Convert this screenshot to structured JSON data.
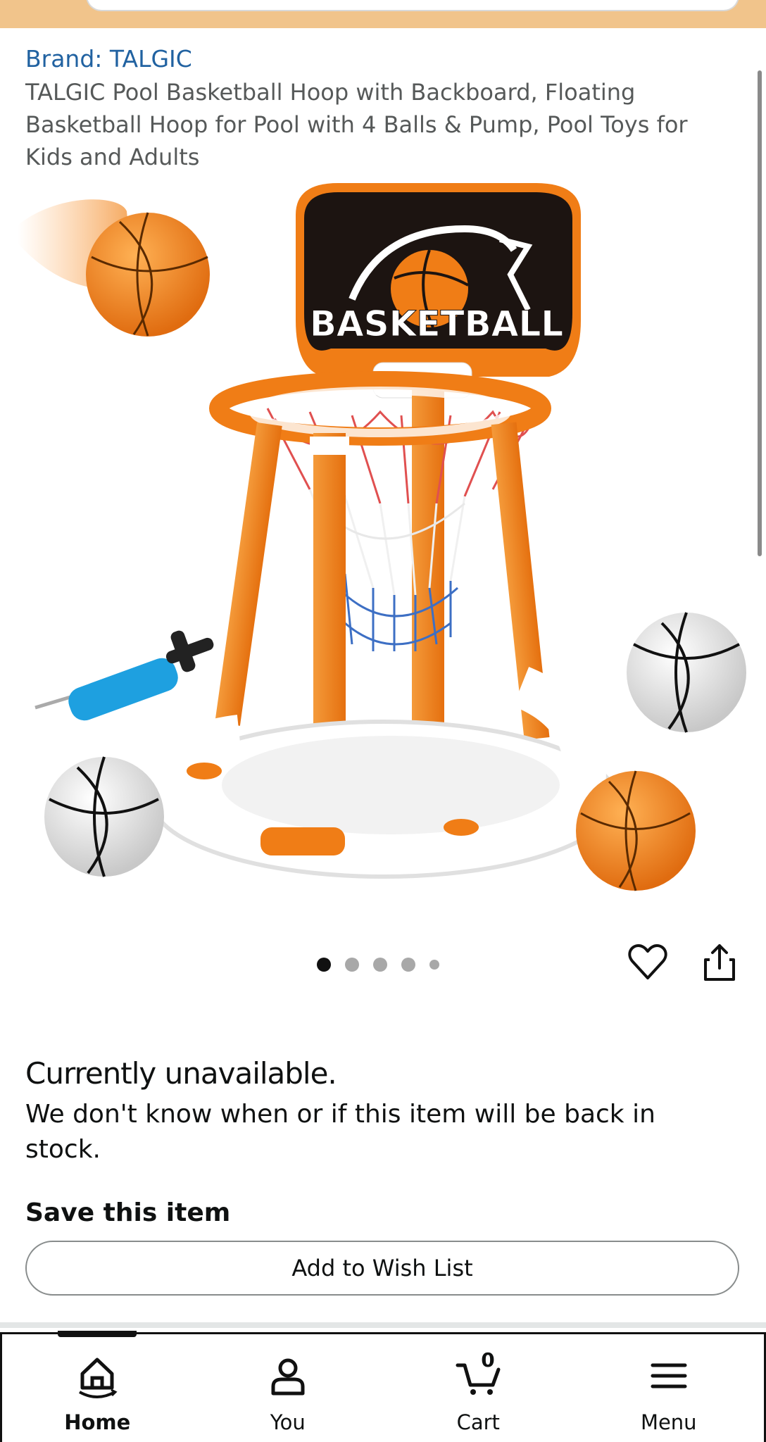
{
  "product": {
    "brand_link": "Brand: TALGIC",
    "title": "TALGIC Pool Basketball Hoop with Backboard, Floating Basketball Hoop for Pool with 4 Balls & Pump, Pool Toys for Kids and Adults",
    "image_backboard_text": "BASKETBALL"
  },
  "carousel": {
    "total_images": 5,
    "active_index": 0
  },
  "actions": {
    "wishlist_icon": "heart-icon",
    "share_icon": "share-icon"
  },
  "availability": {
    "title": "Currently unavailable.",
    "description": "We don't know when or if this item will be back in stock."
  },
  "save": {
    "label": "Save this item",
    "button": "Add to Wish List"
  },
  "bottom_nav": {
    "items": [
      {
        "label": "Home",
        "icon": "home-icon",
        "active": true
      },
      {
        "label": "You",
        "icon": "user-icon",
        "active": false
      },
      {
        "label": "Cart",
        "icon": "cart-icon",
        "active": false,
        "count": "0"
      },
      {
        "label": "Menu",
        "icon": "menu-icon",
        "active": false
      }
    ]
  },
  "colors": {
    "header_orange": "#f1c48b",
    "link_blue": "#2162a1",
    "hoop_orange": "#f07d16"
  }
}
